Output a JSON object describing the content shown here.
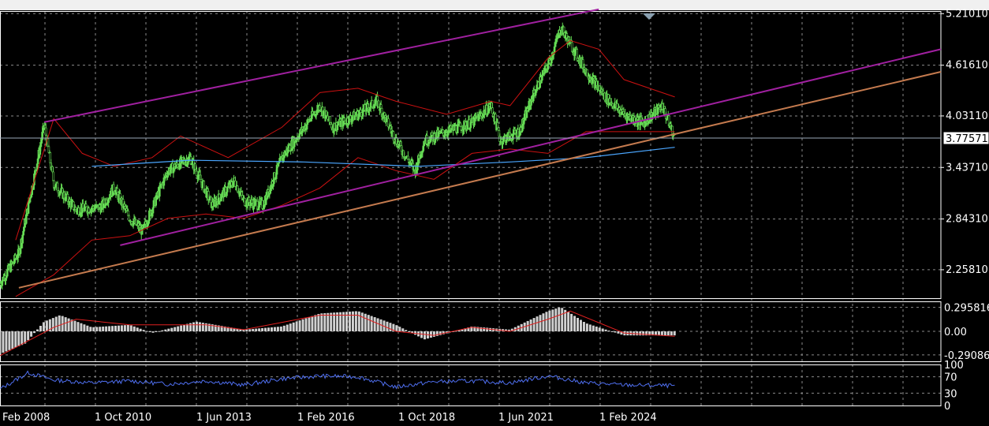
{
  "colors": {
    "background": "#000000",
    "grid": "#8a8a8a",
    "axis_text": "#ffffff",
    "bull_candle": "#66dd55",
    "bollinger": "#cc1111",
    "moving_average": "#4aa6ff",
    "channel": "#a020a0",
    "trendline": "#c47a4e",
    "histogram": "#d0d0d0",
    "signal": "#e02020",
    "rsi": "#4f6ff0",
    "price_line": "#9aa8b8"
  },
  "chart_data": [
    {
      "id": "price",
      "type": "candlestick",
      "ylim": [
        1.93,
        5.24
      ],
      "xlim": [
        "2007-01-01",
        "2031-10-01"
      ],
      "y_ticks": [
        "5.21010",
        "4.61610",
        "4.03110",
        "3.43710",
        "2.84310",
        "2.25810"
      ],
      "current_price": 3.77571,
      "current_price_label": "3.77571",
      "close_series": [
        {
          "x": "2007-01-01",
          "y": 2.1
        },
        {
          "x": "2007-07-01",
          "y": 2.45
        },
        {
          "x": "2008-01-01",
          "y": 3.55
        },
        {
          "x": "2008-03-01",
          "y": 3.93
        },
        {
          "x": "2008-06-01",
          "y": 3.25
        },
        {
          "x": "2009-01-01",
          "y": 2.95
        },
        {
          "x": "2009-09-01",
          "y": 2.98
        },
        {
          "x": "2010-01-01",
          "y": 3.2
        },
        {
          "x": "2010-06-01",
          "y": 2.85
        },
        {
          "x": "2010-10-01",
          "y": 2.7
        },
        {
          "x": "2011-06-01",
          "y": 3.4
        },
        {
          "x": "2012-01-01",
          "y": 3.55
        },
        {
          "x": "2012-08-01",
          "y": 3.0
        },
        {
          "x": "2013-03-01",
          "y": 3.28
        },
        {
          "x": "2013-06-01",
          "y": 3.05
        },
        {
          "x": "2013-12-01",
          "y": 3.0
        },
        {
          "x": "2014-06-01",
          "y": 3.55
        },
        {
          "x": "2014-12-01",
          "y": 3.85
        },
        {
          "x": "2015-06-01",
          "y": 4.15
        },
        {
          "x": "2015-10-01",
          "y": 3.9
        },
        {
          "x": "2016-06-01",
          "y": 4.05
        },
        {
          "x": "2016-12-01",
          "y": 4.2
        },
        {
          "x": "2017-06-01",
          "y": 3.75
        },
        {
          "x": "2017-12-01",
          "y": 3.4
        },
        {
          "x": "2018-03-01",
          "y": 3.75
        },
        {
          "x": "2018-10-01",
          "y": 3.85
        },
        {
          "x": "2019-06-01",
          "y": 3.95
        },
        {
          "x": "2019-12-01",
          "y": 4.15
        },
        {
          "x": "2020-03-01",
          "y": 3.75
        },
        {
          "x": "2020-09-01",
          "y": 3.85
        },
        {
          "x": "2021-01-01",
          "y": 4.25
        },
        {
          "x": "2021-07-01",
          "y": 4.7
        },
        {
          "x": "2021-10-01",
          "y": 5.05
        },
        {
          "x": "2022-06-01",
          "y": 4.55
        },
        {
          "x": "2022-12-01",
          "y": 4.25
        },
        {
          "x": "2023-06-01",
          "y": 4.05
        },
        {
          "x": "2023-12-01",
          "y": 3.95
        },
        {
          "x": "2024-06-01",
          "y": 4.15
        },
        {
          "x": "2024-10-01",
          "y": 3.78
        }
      ],
      "bollinger_upper": [
        {
          "x": "2007-06-01",
          "y": 2.6
        },
        {
          "x": "2008-06-01",
          "y": 4.0
        },
        {
          "x": "2009-03-01",
          "y": 3.6
        },
        {
          "x": "2010-01-01",
          "y": 3.45
        },
        {
          "x": "2011-01-01",
          "y": 3.55
        },
        {
          "x": "2011-10-01",
          "y": 3.8
        },
        {
          "x": "2013-01-01",
          "y": 3.55
        },
        {
          "x": "2014-06-01",
          "y": 3.9
        },
        {
          "x": "2015-06-01",
          "y": 4.3
        },
        {
          "x": "2016-06-01",
          "y": 4.35
        },
        {
          "x": "2017-06-01",
          "y": 4.2
        },
        {
          "x": "2018-10-01",
          "y": 4.05
        },
        {
          "x": "2019-12-01",
          "y": 4.2
        },
        {
          "x": "2020-06-01",
          "y": 4.15
        },
        {
          "x": "2021-06-01",
          "y": 4.7
        },
        {
          "x": "2022-01-01",
          "y": 4.9
        },
        {
          "x": "2022-10-01",
          "y": 4.8
        },
        {
          "x": "2023-06-01",
          "y": 4.45
        },
        {
          "x": "2024-10-01",
          "y": 4.25
        }
      ],
      "bollinger_lower": [
        {
          "x": "2007-06-01",
          "y": 1.95
        },
        {
          "x": "2008-06-01",
          "y": 2.2
        },
        {
          "x": "2009-06-01",
          "y": 2.6
        },
        {
          "x": "2010-06-01",
          "y": 2.65
        },
        {
          "x": "2011-06-01",
          "y": 2.85
        },
        {
          "x": "2012-06-01",
          "y": 2.9
        },
        {
          "x": "2013-06-01",
          "y": 2.85
        },
        {
          "x": "2014-06-01",
          "y": 3.0
        },
        {
          "x": "2015-06-01",
          "y": 3.2
        },
        {
          "x": "2016-06-01",
          "y": 3.55
        },
        {
          "x": "2017-06-01",
          "y": 3.4
        },
        {
          "x": "2018-06-01",
          "y": 3.3
        },
        {
          "x": "2019-06-01",
          "y": 3.6
        },
        {
          "x": "2020-06-01",
          "y": 3.65
        },
        {
          "x": "2021-06-01",
          "y": 3.6
        },
        {
          "x": "2022-06-01",
          "y": 3.85
        },
        {
          "x": "2023-06-01",
          "y": 3.85
        },
        {
          "x": "2024-10-01",
          "y": 3.85
        }
      ],
      "moving_average": [
        {
          "x": "2009-06-01",
          "y": 3.45
        },
        {
          "x": "2012-01-01",
          "y": 3.52
        },
        {
          "x": "2015-01-01",
          "y": 3.5
        },
        {
          "x": "2018-01-01",
          "y": 3.45
        },
        {
          "x": "2020-06-01",
          "y": 3.5
        },
        {
          "x": "2022-06-01",
          "y": 3.55
        },
        {
          "x": "2024-10-01",
          "y": 3.67
        }
      ],
      "channel_upper": [
        {
          "x": "2008-03-01",
          "y": 3.96
        },
        {
          "x": "2022-10-01",
          "y": 5.26
        }
      ],
      "channel_lower": [
        {
          "x": "2010-03-01",
          "y": 2.54
        },
        {
          "x": "2031-10-01",
          "y": 4.8
        }
      ],
      "trendline": [
        {
          "x": "2007-07-01",
          "y": 2.05
        },
        {
          "x": "2031-10-01",
          "y": 4.54
        }
      ]
    },
    {
      "id": "oscillator",
      "type": "bar",
      "ylim": [
        -0.37,
        0.37
      ],
      "y_ticks": [
        "0.295816",
        "0.00",
        "-0.29086"
      ],
      "histogram": [
        {
          "x": "2007-01-01",
          "y": -0.28
        },
        {
          "x": "2007-09-01",
          "y": -0.15
        },
        {
          "x": "2008-03-01",
          "y": 0.12
        },
        {
          "x": "2008-08-01",
          "y": 0.2
        },
        {
          "x": "2009-06-01",
          "y": 0.05
        },
        {
          "x": "2010-06-01",
          "y": 0.08
        },
        {
          "x": "2011-01-01",
          "y": -0.02
        },
        {
          "x": "2011-06-01",
          "y": 0.03
        },
        {
          "x": "2012-03-01",
          "y": 0.12
        },
        {
          "x": "2013-06-01",
          "y": 0.02
        },
        {
          "x": "2014-06-01",
          "y": 0.06
        },
        {
          "x": "2015-06-01",
          "y": 0.22
        },
        {
          "x": "2016-06-01",
          "y": 0.25
        },
        {
          "x": "2017-06-01",
          "y": 0.08
        },
        {
          "x": "2018-03-01",
          "y": -0.1
        },
        {
          "x": "2019-06-01",
          "y": 0.06
        },
        {
          "x": "2020-06-01",
          "y": 0.02
        },
        {
          "x": "2021-06-01",
          "y": 0.25
        },
        {
          "x": "2021-10-01",
          "y": 0.3
        },
        {
          "x": "2022-06-01",
          "y": 0.1
        },
        {
          "x": "2023-06-01",
          "y": -0.05
        },
        {
          "x": "2024-10-01",
          "y": -0.05
        }
      ],
      "signal": [
        {
          "x": "2007-01-01",
          "y": -0.3
        },
        {
          "x": "2008-06-01",
          "y": 0.05
        },
        {
          "x": "2009-01-01",
          "y": 0.15
        },
        {
          "x": "2010-06-01",
          "y": 0.08
        },
        {
          "x": "2012-06-01",
          "y": 0.08
        },
        {
          "x": "2013-06-01",
          "y": 0.02
        },
        {
          "x": "2015-06-01",
          "y": 0.2
        },
        {
          "x": "2016-06-01",
          "y": 0.2
        },
        {
          "x": "2017-06-01",
          "y": 0.0
        },
        {
          "x": "2018-06-01",
          "y": -0.05
        },
        {
          "x": "2019-06-01",
          "y": 0.05
        },
        {
          "x": "2020-06-01",
          "y": 0.0
        },
        {
          "x": "2021-06-01",
          "y": 0.15
        },
        {
          "x": "2022-01-01",
          "y": 0.25
        },
        {
          "x": "2023-06-01",
          "y": -0.02
        },
        {
          "x": "2024-10-01",
          "y": -0.06
        }
      ]
    },
    {
      "id": "rsi",
      "type": "line",
      "ylim": [
        0,
        100
      ],
      "y_ticks": [
        "100",
        "70",
        "30",
        "0"
      ],
      "series": [
        {
          "x": "2007-01-01",
          "y": 40
        },
        {
          "x": "2007-10-01",
          "y": 80
        },
        {
          "x": "2008-06-01",
          "y": 62
        },
        {
          "x": "2009-06-01",
          "y": 55
        },
        {
          "x": "2010-06-01",
          "y": 60
        },
        {
          "x": "2011-06-01",
          "y": 52
        },
        {
          "x": "2012-06-01",
          "y": 60
        },
        {
          "x": "2013-06-01",
          "y": 50
        },
        {
          "x": "2014-06-01",
          "y": 65
        },
        {
          "x": "2015-06-01",
          "y": 72
        },
        {
          "x": "2016-06-01",
          "y": 70
        },
        {
          "x": "2017-06-01",
          "y": 45
        },
        {
          "x": "2018-06-01",
          "y": 58
        },
        {
          "x": "2019-06-01",
          "y": 60
        },
        {
          "x": "2020-06-01",
          "y": 55
        },
        {
          "x": "2021-06-01",
          "y": 72
        },
        {
          "x": "2022-06-01",
          "y": 55
        },
        {
          "x": "2023-06-01",
          "y": 50
        },
        {
          "x": "2024-10-01",
          "y": 48
        }
      ]
    }
  ],
  "time_axis": {
    "labels": [
      "Feb 2008",
      "1 Oct 2010",
      "1 Jun 2013",
      "1 Feb 2016",
      "1 Oct 2018",
      "1 Jun 2021",
      "1 Feb 2024"
    ]
  }
}
